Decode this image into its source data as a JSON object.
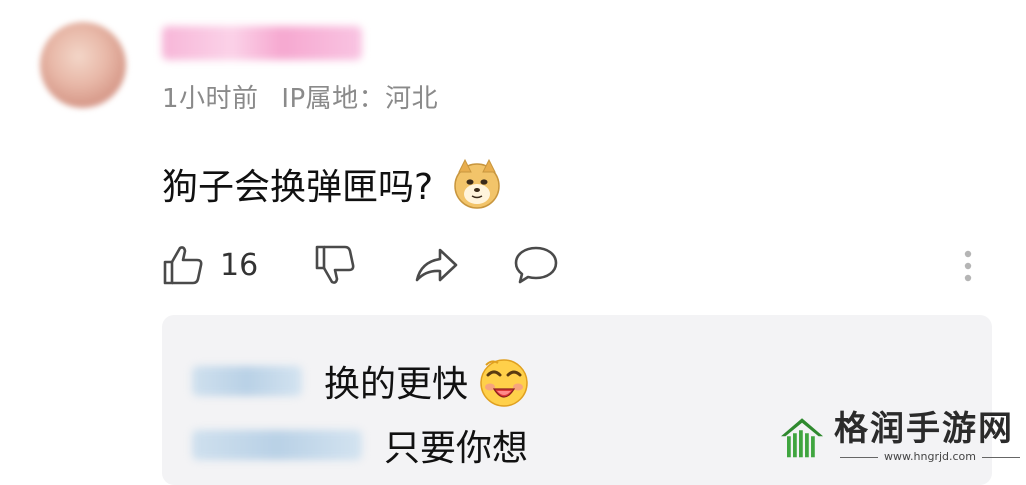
{
  "comment": {
    "username": "",
    "meta": {
      "time": "1小时前",
      "ip_location": "IP属地：河北"
    },
    "text": "狗子会换弹匣吗?",
    "emoji": "doge-emoji",
    "actions": {
      "like_count": "16",
      "icons": [
        "thumbs-up-icon",
        "thumbs-down-icon",
        "share-icon",
        "comment-icon",
        "more-vertical-icon"
      ]
    }
  },
  "replies": [
    {
      "text": "换的更快",
      "emoji": "laughing-emoji"
    },
    {
      "text": "只要你想"
    }
  ],
  "watermark": {
    "title": "格润手游网",
    "url": "www.hngrjd.com"
  },
  "colors": {
    "meta_gray": "#8a8a8a",
    "reply_bg": "#f3f3f5",
    "logo_green": "#2f8a2f"
  }
}
